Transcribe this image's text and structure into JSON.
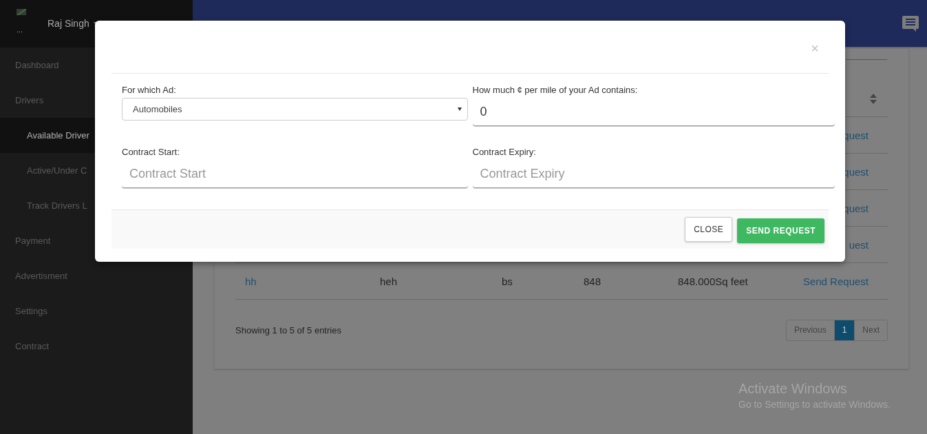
{
  "sidebar": {
    "logo_text": "...",
    "user_name": "Raj Singh",
    "items": [
      {
        "label": "Dashboard",
        "selected": false
      },
      {
        "label": "Drivers",
        "selected": false,
        "children": [
          {
            "label": "Available Driver",
            "selected": true
          },
          {
            "label": "Active/Under C",
            "selected": false
          },
          {
            "label": "Track Drivers L",
            "selected": false
          }
        ]
      },
      {
        "label": "Payment",
        "selected": false
      },
      {
        "label": "Advertisment",
        "selected": false
      },
      {
        "label": "Settings",
        "selected": false
      },
      {
        "label": "Contract",
        "selected": false
      }
    ]
  },
  "table": {
    "rows": [
      {
        "column_6": "quest"
      },
      {
        "column_6": "quest"
      },
      {
        "column_6": "quest"
      },
      {
        "column_6": "uest"
      },
      {
        "column_1": "hh",
        "column_2": "heh",
        "column_3": "bs",
        "column_4": "848",
        "column_5": "848.000Sq feet",
        "column_6": "Send Request"
      }
    ],
    "info": "Showing 1 to 5 of 5 entries",
    "pagination": [
      {
        "label": "Previous",
        "selected": false
      },
      {
        "label": "1",
        "selected": true
      },
      {
        "label": "Next",
        "selected": false
      }
    ]
  },
  "modal": {
    "close_symbol": "×",
    "fields": [
      {
        "label": "For which Ad:",
        "kind": "select",
        "value": "Automobiles"
      },
      {
        "label": "How much ¢ per mile of your Ad contains:",
        "kind": "input",
        "value": "0"
      },
      {
        "label": "Contract Start:",
        "kind": "input",
        "placeholder": "Contract Start"
      },
      {
        "label": "Contract Expiry:",
        "kind": "input",
        "placeholder": "Contract Expiry"
      }
    ],
    "buttons": [
      {
        "label": "CLOSE",
        "kind": "default"
      },
      {
        "label": "SEND REQUEST",
        "kind": "primary"
      }
    ]
  },
  "watermark": {
    "title": "Activate Windows",
    "subtitle": "Go to Settings to activate Windows."
  }
}
